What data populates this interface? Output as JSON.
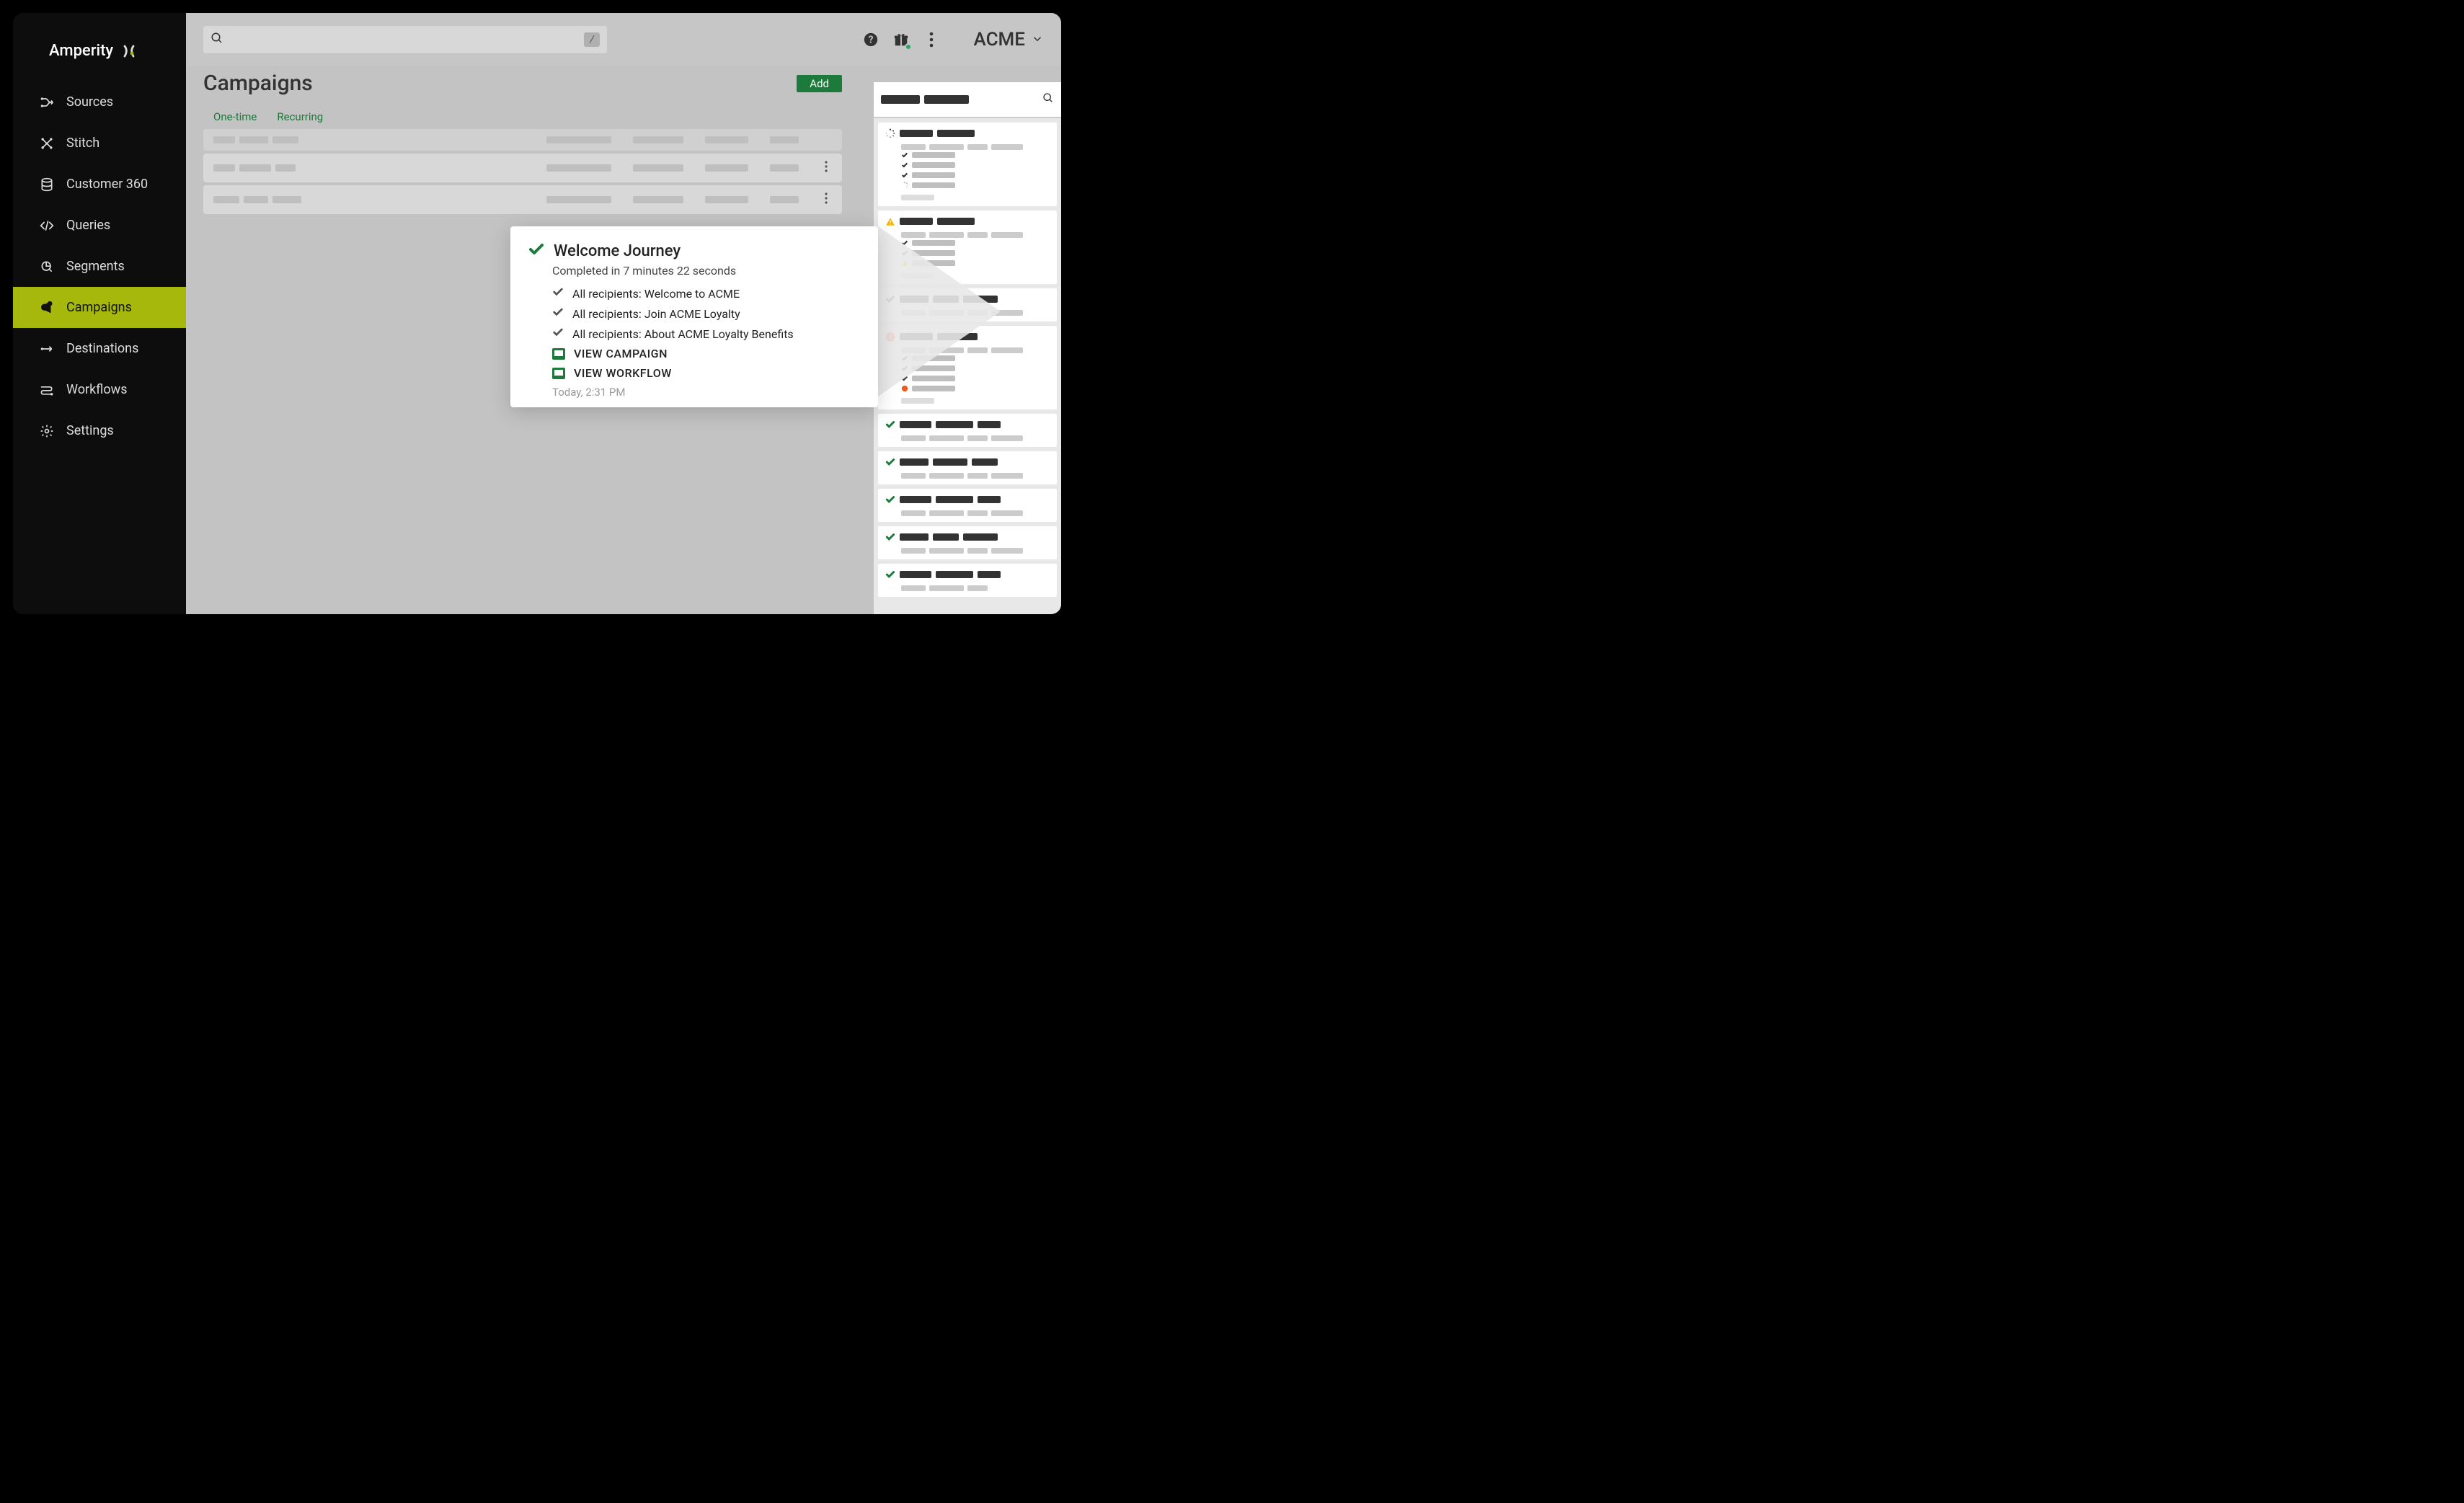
{
  "brand": {
    "name": "Amperity"
  },
  "sidebar": {
    "items": [
      {
        "label": "Sources",
        "icon": "sources-icon"
      },
      {
        "label": "Stitch",
        "icon": "stitch-icon"
      },
      {
        "label": "Customer 360",
        "icon": "database-icon"
      },
      {
        "label": "Queries",
        "icon": "code-icon"
      },
      {
        "label": "Segments",
        "icon": "segments-icon"
      },
      {
        "label": "Campaigns",
        "icon": "campaigns-icon",
        "active": true
      },
      {
        "label": "Destinations",
        "icon": "destinations-icon"
      },
      {
        "label": "Workflows",
        "icon": "workflows-icon"
      },
      {
        "label": "Settings",
        "icon": "settings-icon"
      }
    ]
  },
  "topbar": {
    "search_placeholder": "",
    "shortcut_hint": "/",
    "tenant": "ACME"
  },
  "page": {
    "title": "Campaigns",
    "add_label": "Add",
    "tabs": [
      {
        "label": "One-time"
      },
      {
        "label": "Recurring"
      }
    ]
  },
  "popover": {
    "title": "Welcome Journey",
    "subtitle": "Completed in 7 minutes 22 seconds",
    "steps": [
      "All recipients: Welcome to ACME",
      "All recipients: Join ACME Loyalty",
      "All recipients: About ACME Loyalty Benefits"
    ],
    "actions": [
      "VIEW CAMPAIGN",
      "VIEW WORKFLOW"
    ],
    "timestamp": "Today, 2:31 PM"
  },
  "notifications": {
    "cards": [
      {
        "status": "in-progress",
        "rows": [
          "check",
          "check",
          "check",
          "spinner"
        ]
      },
      {
        "status": "warning",
        "rows": [
          "check",
          "check",
          "warning"
        ]
      },
      {
        "status": "success",
        "rows": []
      },
      {
        "status": "error",
        "rows": [
          "check",
          "check",
          "check",
          "error"
        ]
      },
      {
        "status": "success",
        "rows": []
      },
      {
        "status": "success",
        "rows": []
      },
      {
        "status": "success",
        "rows": []
      },
      {
        "status": "success",
        "rows": []
      },
      {
        "status": "success",
        "rows": []
      }
    ]
  },
  "colors": {
    "accent_green": "#1c7a3a",
    "sidebar_active": "#a5b80b",
    "warning": "#f7b500",
    "error": "#ee5b22"
  }
}
